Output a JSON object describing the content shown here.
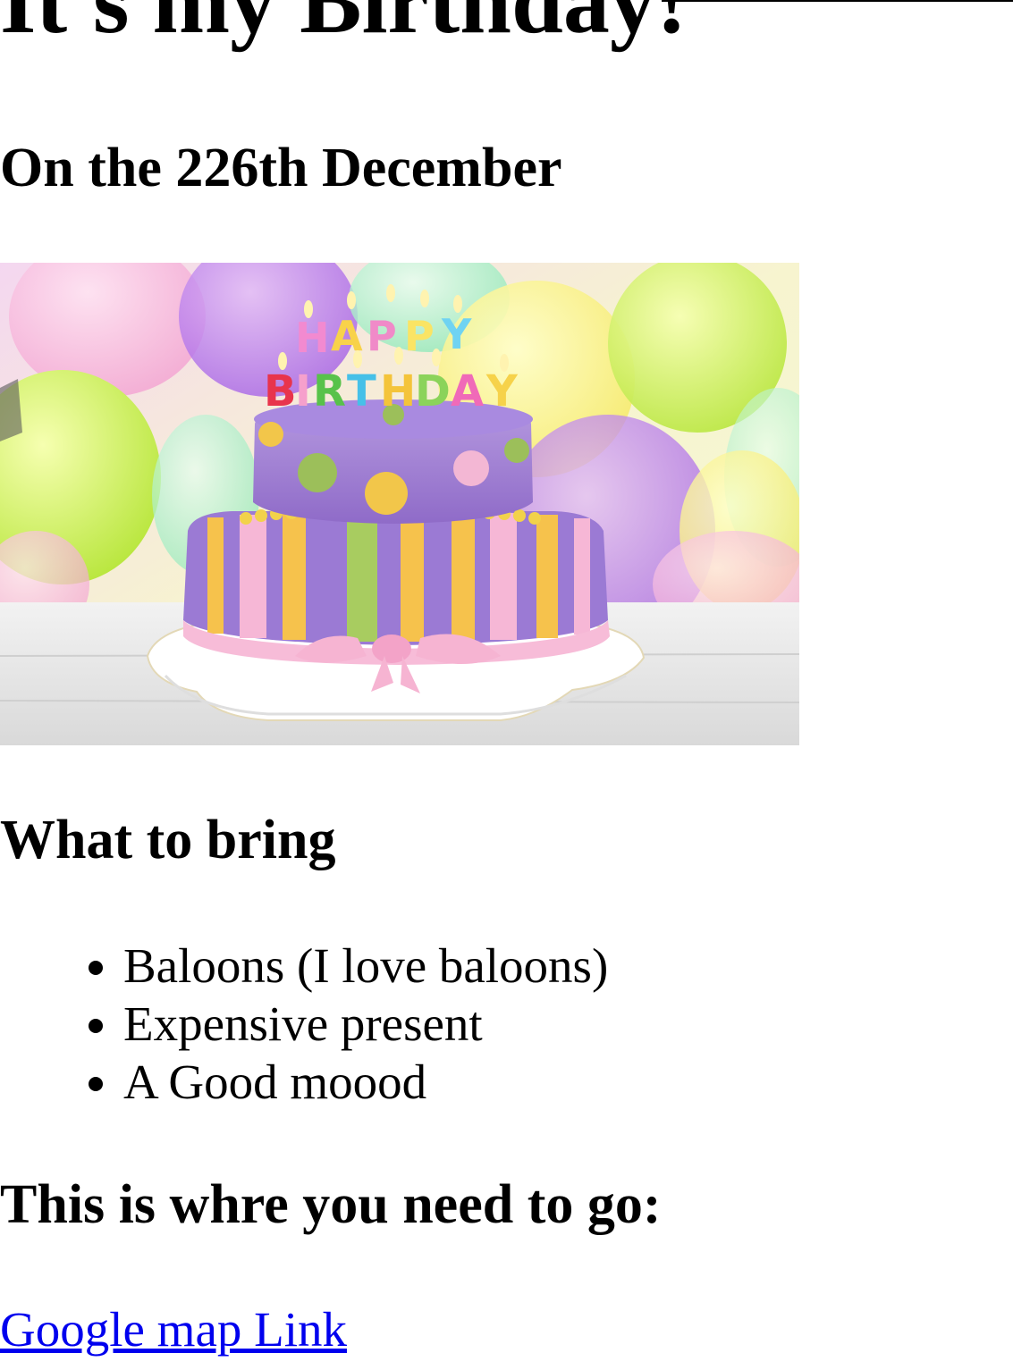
{
  "page": {
    "title": "It's my Birthday!",
    "date_heading": "On the 226th December"
  },
  "image": {
    "alt": "Birthday cake with HAPPY BIRTHDAY candles",
    "candle_text_line1": "HAPPY",
    "candle_text_line2": "BIRTHDAY"
  },
  "bring": {
    "heading": "What to bring",
    "items": [
      "Baloons (I love baloons)",
      "Expensive present",
      "A Good moood"
    ]
  },
  "directions": {
    "heading": "This is whre you need to go:",
    "link_text": "Google map Link"
  },
  "colors": {
    "link": "#0000ee",
    "text": "#000000",
    "background": "#ffffff"
  }
}
